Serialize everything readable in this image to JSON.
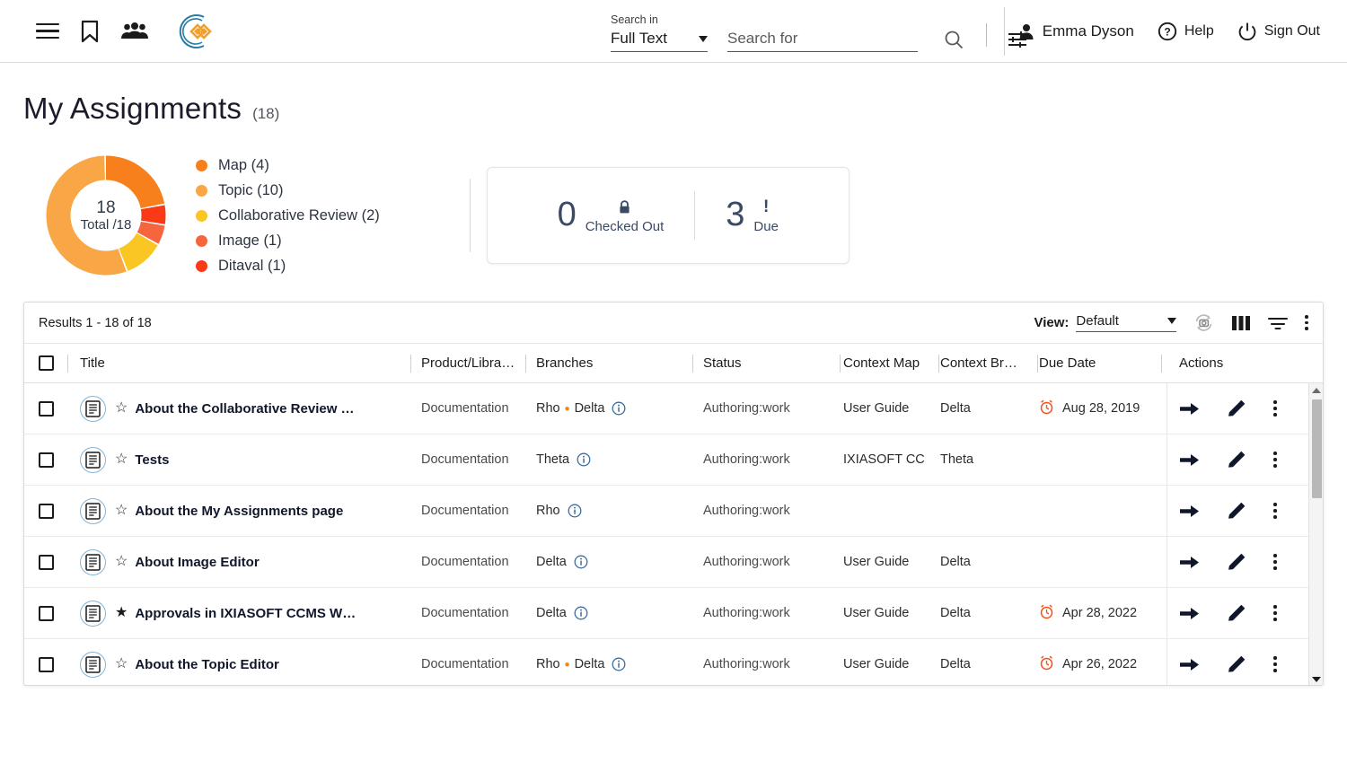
{
  "header": {
    "icons": {
      "menu": "hamburger-menu-icon",
      "bookmark": "bookmark-icon",
      "people": "people-group-icon",
      "logo": "ixiasoft-logo-icon"
    },
    "search": {
      "search_in_label": "Search in",
      "search_in_value": "Full Text",
      "search_for_placeholder": "Search for",
      "search_for_value": "",
      "search_icon": "search-icon",
      "filter_icon": "search-settings-icon"
    },
    "user": {
      "name": "Emma Dyson",
      "icon": "person-icon"
    },
    "help": {
      "label": "Help",
      "icon": "question-circle-icon"
    },
    "sign_out": {
      "label": "Sign Out",
      "icon": "power-icon"
    }
  },
  "page": {
    "title": "My Assignments",
    "count": "(18)"
  },
  "chart_data": {
    "type": "pie",
    "title": "My Assignments",
    "center_value": "18",
    "center_label": "Total /18",
    "total": 18,
    "categories": [
      "Map",
      "Topic",
      "Collaborative Review",
      "Image",
      "Ditaval"
    ],
    "values": [
      4,
      10,
      2,
      1,
      1
    ],
    "colors": [
      "#f77f1c",
      "#f9a746",
      "#f9c623",
      "#f5663f",
      "#fa3a16"
    ],
    "legend": [
      {
        "label": "Map (4)",
        "color": "#f77f1c"
      },
      {
        "label": "Topic (10)",
        "color": "#f9a746"
      },
      {
        "label": "Collaborative Review (2)",
        "color": "#f9c623"
      },
      {
        "label": "Image (1)",
        "color": "#f5663f"
      },
      {
        "label": "Ditaval (1)",
        "color": "#fa3a16"
      }
    ],
    "legend_position": "right",
    "grid": false
  },
  "stats": {
    "checked_out": {
      "value": "0",
      "label": "Checked Out",
      "icon": "lock-icon"
    },
    "due": {
      "value": "3",
      "label": "Due",
      "icon": "exclamation-icon"
    }
  },
  "table": {
    "results_text": "Results 1 - 18 of 18",
    "view_label": "View:",
    "view_value": "Default",
    "toolbar_icons": {
      "refresh": "refresh-snapshot-icon",
      "columns": "columns-icon",
      "filter": "filter-icon",
      "more": "more-vertical-icon"
    },
    "columns": [
      "Title",
      "Product/Libra…",
      "Branches",
      "Status",
      "Context Map",
      "Context Br…",
      "Due Date",
      "Actions"
    ],
    "rows": [
      {
        "title": "About the Collaborative Review …",
        "starred": false,
        "product": "Documentation",
        "branches": [
          "Rho",
          "Delta"
        ],
        "status": "Authoring:work",
        "context_map": "User Guide",
        "context_branch": "Delta",
        "due_date": "Aug 28, 2019"
      },
      {
        "title": "Tests",
        "starred": false,
        "product": "Documentation",
        "branches": [
          "Theta"
        ],
        "status": "Authoring:work",
        "context_map": "IXIASOFT CC",
        "context_branch": "Theta",
        "due_date": ""
      },
      {
        "title": "About the My Assignments page",
        "starred": false,
        "product": "Documentation",
        "branches": [
          "Rho"
        ],
        "status": "Authoring:work",
        "context_map": "",
        "context_branch": "",
        "due_date": ""
      },
      {
        "title": "About Image Editor",
        "starred": false,
        "product": "Documentation",
        "branches": [
          "Delta"
        ],
        "status": "Authoring:work",
        "context_map": "User Guide",
        "context_branch": "Delta",
        "due_date": ""
      },
      {
        "title": "Approvals in IXIASOFT CCMS W…",
        "starred": true,
        "product": "Documentation",
        "branches": [
          "Delta"
        ],
        "status": "Authoring:work",
        "context_map": "User Guide",
        "context_branch": "Delta",
        "due_date": "Apr 28, 2022"
      },
      {
        "title": "About the Topic Editor",
        "starred": false,
        "product": "Documentation",
        "branches": [
          "Rho",
          "Delta"
        ],
        "status": "Authoring:work",
        "context_map": "User Guide",
        "context_branch": "Delta",
        "due_date": "Apr 26, 2022"
      }
    ],
    "row_actions": {
      "open": "arrow-right-icon",
      "edit": "pencil-icon",
      "more": "more-vertical-icon"
    }
  },
  "colors": {
    "accent_orange": "#f08a1e",
    "logo_teal": "#2a7ca3",
    "doc_icon_blue": "#7fb6dd",
    "stat_text": "#3a4a63",
    "due_alarm": "#f5511e"
  }
}
